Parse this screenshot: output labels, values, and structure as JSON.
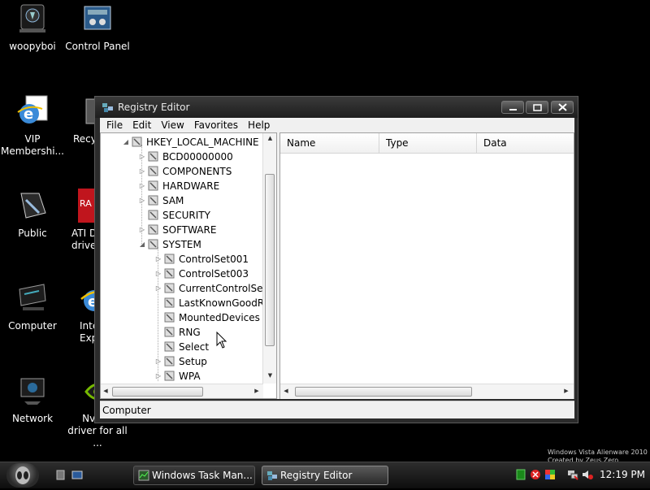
{
  "desktop": {
    "icons": [
      {
        "label": "woopyboi",
        "icon": "user-folder-icon"
      },
      {
        "label": "Control Panel",
        "icon": "control-panel-icon"
      },
      {
        "label": "VIP\nMembershi...",
        "icon": "internet-explorer-icon"
      },
      {
        "label": "Recy",
        "icon": "recycle-bin-icon"
      },
      {
        "label": "Public",
        "icon": "public-folder-icon"
      },
      {
        "label": "ATI D\ndrive",
        "icon": "ati-driver-icon"
      },
      {
        "label": "Computer",
        "icon": "computer-icon"
      },
      {
        "label": "Inte\nExp",
        "icon": "internet-explorer-icon"
      },
      {
        "label": "Network",
        "icon": "network-icon"
      },
      {
        "label": "Nvidia\ndriver for all ...",
        "icon": "nvidia-icon"
      }
    ],
    "watermark_line1": "Windows Vista Alienware 2010",
    "watermark_line2": "Created by Zeus Zero..."
  },
  "window": {
    "title": "Registry Editor",
    "menu": [
      "File",
      "Edit",
      "View",
      "Favorites",
      "Help"
    ],
    "tree": {
      "root": "HKEY_LOCAL_MACHINE",
      "children": [
        "BCD00000000",
        "COMPONENTS",
        "HARDWARE",
        "SAM",
        "SECURITY",
        "SOFTWARE",
        "SYSTEM"
      ],
      "system_children": [
        "ControlSet001",
        "ControlSet003",
        "CurrentControlSet",
        "LastKnownGoodR",
        "MountedDevices",
        "RNG",
        "Select",
        "Setup",
        "WPA"
      ]
    },
    "columns": [
      "Name",
      "Type",
      "Data"
    ],
    "status": "Computer"
  },
  "taskbar": {
    "tasks": [
      "Windows Task Man...",
      "Registry Editor"
    ],
    "clock": "12:19 PM"
  },
  "colors": {
    "accent": "#1e90ff",
    "background": "#000000"
  }
}
